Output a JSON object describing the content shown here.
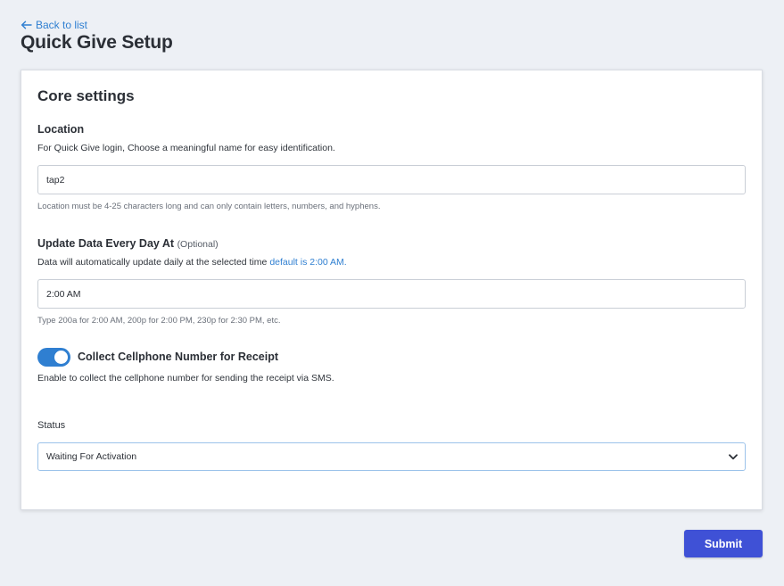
{
  "header": {
    "back_link": "Back to list",
    "title": "Quick Give Setup"
  },
  "card": {
    "title": "Core settings",
    "location": {
      "label": "Location",
      "description": "For Quick Give login, Choose a meaningful name for easy identification.",
      "value": "tap2",
      "help": "Location must be 4-25 characters long and can only contain letters, numbers, and hyphens."
    },
    "update_time": {
      "label": "Update Data Every Day At",
      "optional": "(Optional)",
      "description": "Data will automatically update daily at the selected time",
      "description_link": "default is 2:00 AM.",
      "value": "2:00 AM",
      "help": "Type 200a for 2:00 AM, 200p for 2:00 PM, 230p for 2:30 PM, etc."
    },
    "cellphone": {
      "label": "Collect Cellphone Number for Receipt",
      "enabled": true,
      "description": "Enable to collect the cellphone number for sending the receipt via SMS."
    },
    "status": {
      "label": "Status",
      "selected": "Waiting For Activation"
    }
  },
  "actions": {
    "submit_label": "Submit"
  },
  "colors": {
    "accent": "#2f7fd1",
    "submit": "#3f51d6",
    "background": "#edf0f5"
  },
  "icons": {
    "back": "arrow-left-icon",
    "select": "chevron-down-icon"
  }
}
